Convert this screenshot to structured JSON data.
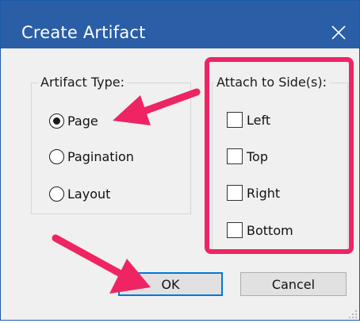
{
  "window": {
    "title": "Create Artifact"
  },
  "artifact_type": {
    "legend": "Artifact Type:",
    "options": [
      "Page",
      "Pagination",
      "Layout"
    ],
    "selected": "Page"
  },
  "attach_sides": {
    "legend": "Attach to Side(s):",
    "options": [
      "Left",
      "Top",
      "Right",
      "Bottom"
    ]
  },
  "buttons": {
    "ok": "OK",
    "cancel": "Cancel"
  },
  "annotations": {
    "highlight_color": "#ee2463"
  },
  "icons": [
    "close-icon",
    "resize-grip-icon"
  ]
}
